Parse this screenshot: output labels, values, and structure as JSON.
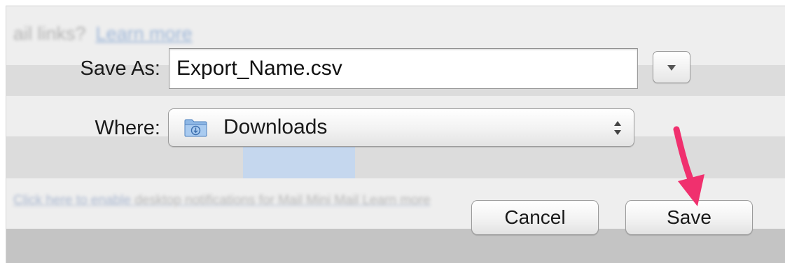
{
  "dialog": {
    "save_as_label": "Save As:",
    "filename_value": "Export_Name.csv",
    "where_label": "Where:",
    "where_value": "Downloads",
    "cancel_label": "Cancel",
    "save_label": "Save",
    "folder_icon": "downloads-folder-icon",
    "disclosure_icon": "chevron-down-icon",
    "popup_icon": "up-down-arrows-icon"
  },
  "background": {
    "top_text": "ail links?",
    "top_link": "Learn more",
    "notice_link": "Click here to enable",
    "notice_rest": " desktop notifications for Mail Mini Mail  Learn more"
  },
  "annotation": {
    "arrow_color": "#f0306e"
  },
  "colors": {
    "dialog_bg": "#eeeeee",
    "field_border": "#9c9c9c",
    "text": "#1a1a1a"
  }
}
